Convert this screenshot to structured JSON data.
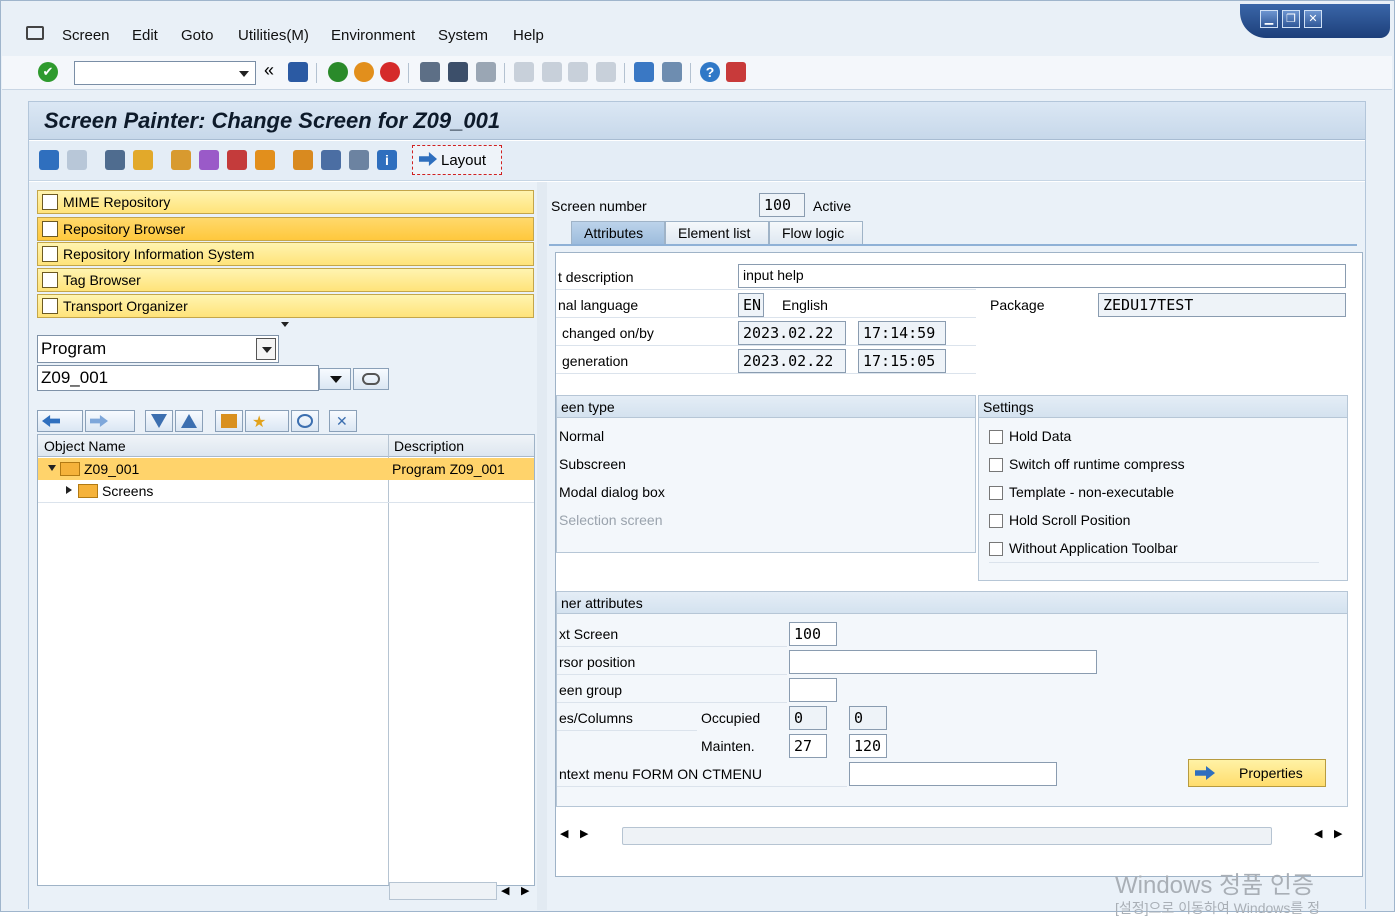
{
  "menu": {
    "items": [
      "Screen",
      "Edit",
      "Goto",
      "Utilities(M)",
      "Environment",
      "System",
      "Help"
    ]
  },
  "window_controls": [
    "▁",
    "❐",
    "✕"
  ],
  "toolbar": {
    "command_field_value": "",
    "icons": [
      "enter-icon",
      "save-icon",
      "back-icon",
      "exit-icon",
      "cancel-icon",
      "print-icon",
      "find-icon",
      "find-next-icon",
      "first-page-icon",
      "prev-page-icon",
      "next-page-icon",
      "last-page-icon",
      "new-session-icon",
      "shortcut-icon",
      "help-icon",
      "customize-icon"
    ],
    "colors": {
      "enter": "#2e9a2e",
      "back": "#2a8a2a",
      "exit": "#e28f1c",
      "cancel": "#d52a2a",
      "save": "#2b5aa3",
      "help": "#2f78c7"
    }
  },
  "title": "Screen Painter: Change Screen for Z09_001",
  "appbar": {
    "layout_label": "Layout"
  },
  "nav": {
    "buttons": [
      "MIME Repository",
      "Repository Browser",
      "Repository Information System",
      "Tag Browser",
      "Transport Organizer"
    ],
    "object_type": "Program",
    "object_name": "Z09_001"
  },
  "tree": {
    "headers": [
      "Object Name",
      "Description"
    ],
    "rows": [
      {
        "name": "Z09_001",
        "desc": "Program Z09_001"
      },
      {
        "name": "Screens",
        "desc": ""
      }
    ]
  },
  "screen": {
    "number_label": "Screen number",
    "number": "100",
    "status": "Active",
    "tabs": [
      "Attributes",
      "Element list",
      "Flow logic"
    ],
    "attributes": {
      "short_desc_label": "t description",
      "short_desc": "input help",
      "orig_lang_label": "nal language",
      "lang_code": "EN",
      "lang_name": "English",
      "package_label": "Package",
      "package": "ZEDU17TEST",
      "changed_label": "changed on/by",
      "changed_date": "2023.02.22",
      "changed_time": "17:14:59",
      "generation_label": "generation",
      "generation_date": "2023.02.22",
      "generation_time": "17:15:05"
    },
    "screen_type": {
      "title": "een type",
      "options": [
        "Normal",
        "Subscreen",
        "Modal dialog box",
        "Selection screen"
      ]
    },
    "settings": {
      "title": "Settings",
      "options": [
        "Hold Data",
        "Switch off runtime compress",
        "Template - non-executable",
        "Hold Scroll Position",
        "Without Application Toolbar"
      ]
    },
    "other": {
      "title": "ner attributes",
      "next_screen_label": "xt Screen",
      "next_screen": "100",
      "cursor_label": "rsor position",
      "cursor": "",
      "group_label": "een group",
      "group": "",
      "lines_label": "es/Columns",
      "occupied_label": "Occupied",
      "occupied_lines": "0",
      "occupied_cols": "0",
      "mainten_label": "Mainten.",
      "mainten_lines": "27",
      "mainten_cols": "120",
      "context_label": "ntext menu FORM ON CTMENU",
      "context": "",
      "properties_label": "Properties"
    }
  },
  "watermark": {
    "line1": "Windows 정품 인증",
    "line2": "[설정]으로 이동하여 Windows를 정"
  }
}
